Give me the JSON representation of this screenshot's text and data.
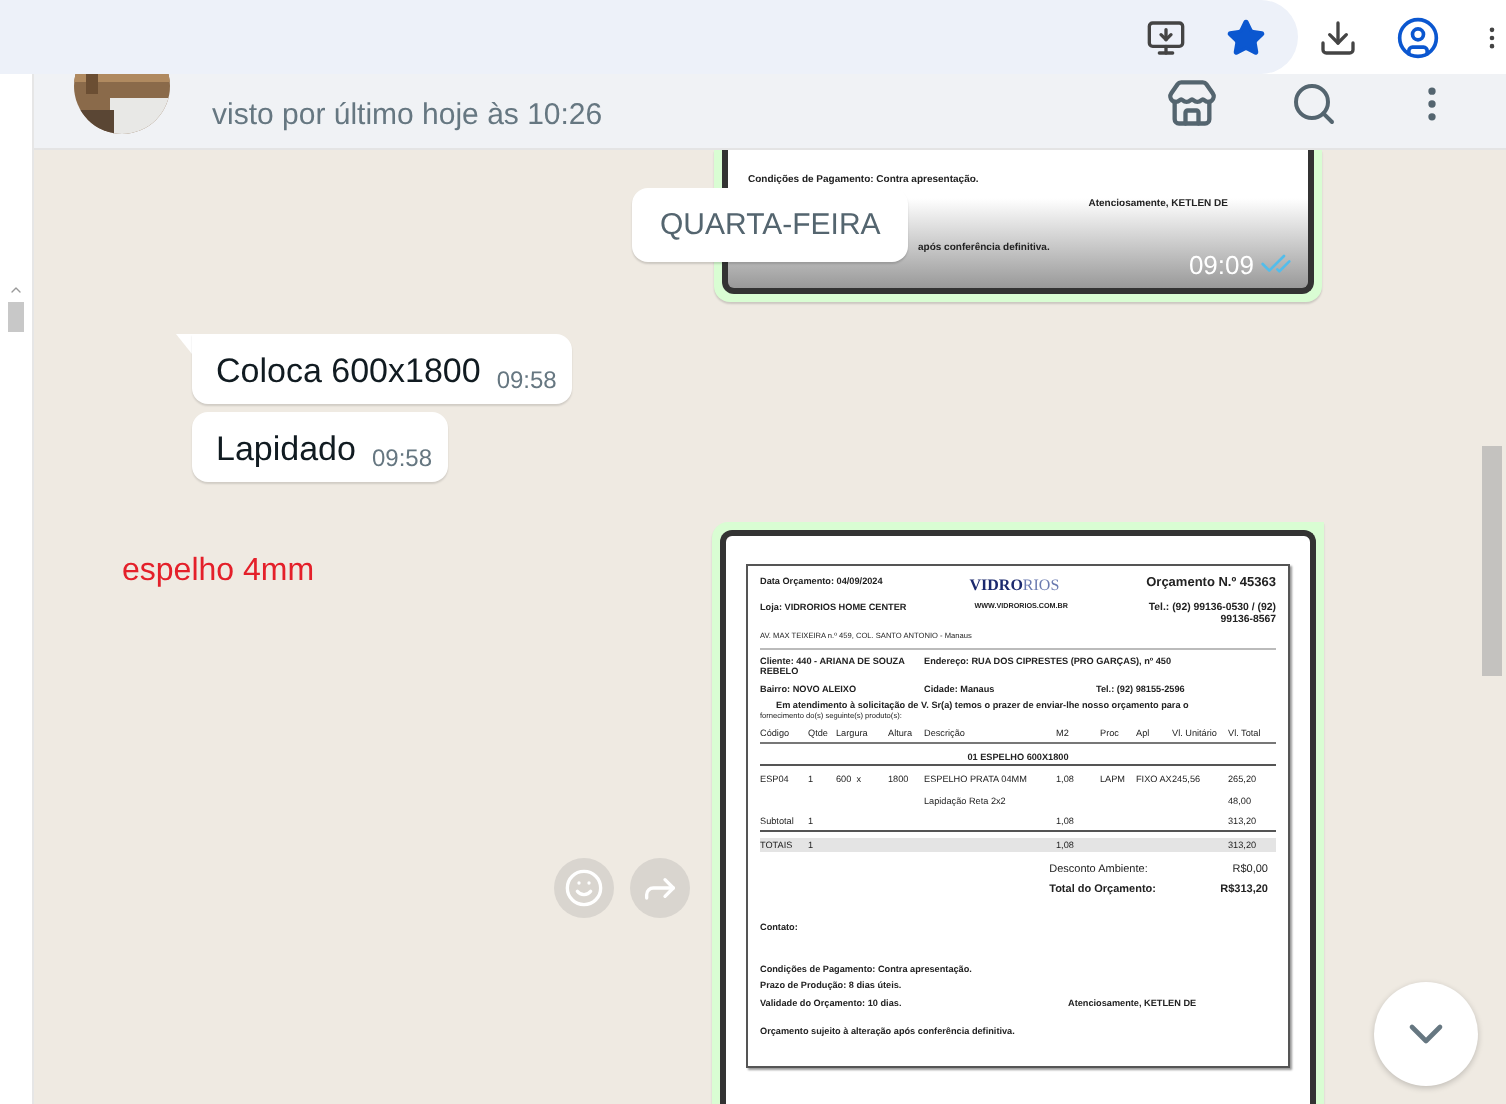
{
  "chat_header": {
    "status": "visto por último hoje às 10:26"
  },
  "messages": [
    {
      "time": "09:09",
      "read": true,
      "lines": [
        "Condições de Pagamento: Contra apresentação.",
        "Atenciosamente, KETLEN DE",
        "após conferência definitiva."
      ]
    },
    {
      "kind": "date",
      "text": "QUARTA-FEIRA"
    },
    {
      "kind": "text",
      "text": "Coloca 600x1800",
      "time": "09:58"
    },
    {
      "kind": "text",
      "text": "Lapidado",
      "time": "09:58"
    }
  ],
  "annotation": {
    "text": "espelho 4mm"
  },
  "quote": {
    "date": "Data Orçamento: 04/09/2024",
    "logo_bold": "VIDRO",
    "logo_light": "RIOS",
    "number": "Orçamento N.º 45363",
    "store": "Loja: VIDRORIOS HOME CENTER",
    "website": "WWW.VIDRORIOS.COM.BR",
    "phone": "Tel.: (92) 99136-0530 / (92) 99136-8567",
    "address": "AV. MAX TEIXEIRA n.º 459, COL. SANTO ANTONIO - Manaus",
    "client": "Cliente: 440 - ARIANA DE SOUZA REBELO",
    "client_address": "Endereço: RUA DOS CIPRESTES (PRO GARÇAS), nº 450",
    "district": "Bairro: NOVO ALEIXO",
    "city": "Cidade: Manaus",
    "client_phone": "Tel.: (92) 98155-2596",
    "intro": "Em atendimento à solicitação de V. Sr(a) temos o prazer de enviar-lhe nosso orçamento para o",
    "intro_2": "fornecimento do(s) seguinte(s) produto(s):",
    "columns": [
      "Código",
      "Qtde",
      "Largura",
      "Altura",
      "Descrição",
      "M2",
      "Proc",
      "Apl",
      "Vl. Unitário",
      "Vl. Total"
    ],
    "group": "01 ESPELHO 600X1800",
    "rows": [
      {
        "kind": "item",
        "cells": [
          "ESP04",
          "1",
          "600  x",
          "1800",
          "ESPELHO PRATA 04MM",
          "1,08",
          "LAPM",
          "FIXO AX",
          "245,56",
          "265,20"
        ]
      },
      {
        "kind": "extra",
        "description": "Lapidação Reta 2x2",
        "total": "48,00"
      },
      {
        "kind": "sum",
        "label": "Subtotal",
        "qty": "1",
        "m2": "1,08",
        "total": "313,20"
      },
      {
        "kind": "totals",
        "label": "TOTAIS",
        "qty": "1",
        "m2": "1,08",
        "total": "313,20"
      }
    ],
    "discount_label": "Desconto Ambiente:",
    "discount": "R$0,00",
    "total_label": "Total do Orçamento:",
    "total": "R$313,20",
    "contact": "Contato:",
    "payment": "Condições de Pagamento: Contra apresentação.",
    "production": "Prazo de Produção: 8 dias úteis.",
    "validity": "Validade do Orçamento: 10 dias.",
    "regards": "Atenciosamente, KETLEN DE",
    "note": "Orçamento sujeito à alteração após conferência definitiva."
  }
}
